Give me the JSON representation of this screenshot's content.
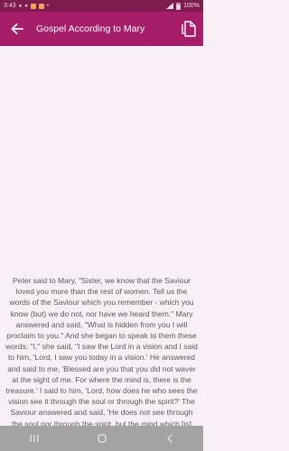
{
  "status_bar": {
    "time": "3:43",
    "battery": "100%"
  },
  "app_bar": {
    "title": "Gospel According to Mary",
    "back_icon": "arrow-left-icon",
    "action_icon": "copy-icon"
  },
  "content": {
    "text": "Peter said to Mary, \"Sister, we know that the Saviour loved you more than the rest of women. Tell us the words of the Saviour which you remember - which you know (but) we do not, nor have we heard them.\" Mary answered and said, \"What is hidden from you I will proclaim to you.\" And she began to speak to them these words: \"I,\" she said, \"I saw the Lord in a vision and I said to him, 'Lord, I saw you today in a vision.' He answered and said to me, 'Blessed are you that you did not waver at the sight of me. For where the mind is, there is the treasure.' I said to him, 'Lord, how does he who sees the vision see it through the soul or through the spirit?' The Saviour answered and said, 'He does not see through the soul nor through the spirit, but the mind which [is] between the two - that is [what] sees the vision...'"
  },
  "nav_bar": {
    "recent_icon": "recent-apps-icon",
    "home_icon": "home-icon",
    "back_icon": "back-chevron-icon"
  },
  "colors": {
    "status_bar": "#7d1c4d",
    "app_bar": "#a61e6a",
    "background": "#f8f0f6",
    "text": "#5a5a5a",
    "nav_bar": "#a3a3a3"
  }
}
